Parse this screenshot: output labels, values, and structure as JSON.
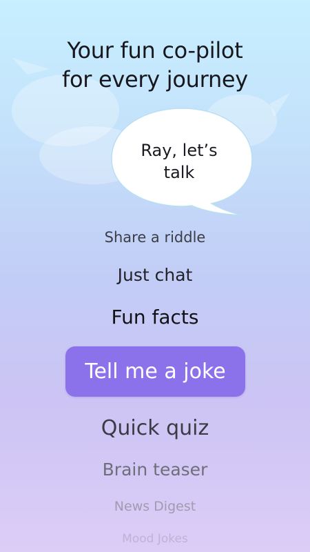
{
  "headline": {
    "line1": "Your fun co-pilot",
    "line2": "for every journey"
  },
  "bubble": {
    "line1": "Ray, let’s",
    "line2": "talk"
  },
  "options": {
    "riddle": "Share a riddle",
    "chat": "Just chat",
    "facts": "Fun facts",
    "joke": "Tell me a joke",
    "quiz": "Quick quiz",
    "teaser": "Brain teaser",
    "news": "News Digest",
    "mood": "Mood Jokes"
  },
  "colors": {
    "accent": "#8c72ea",
    "background_top": "#c7efff",
    "background_bottom": "#dccdf7"
  }
}
